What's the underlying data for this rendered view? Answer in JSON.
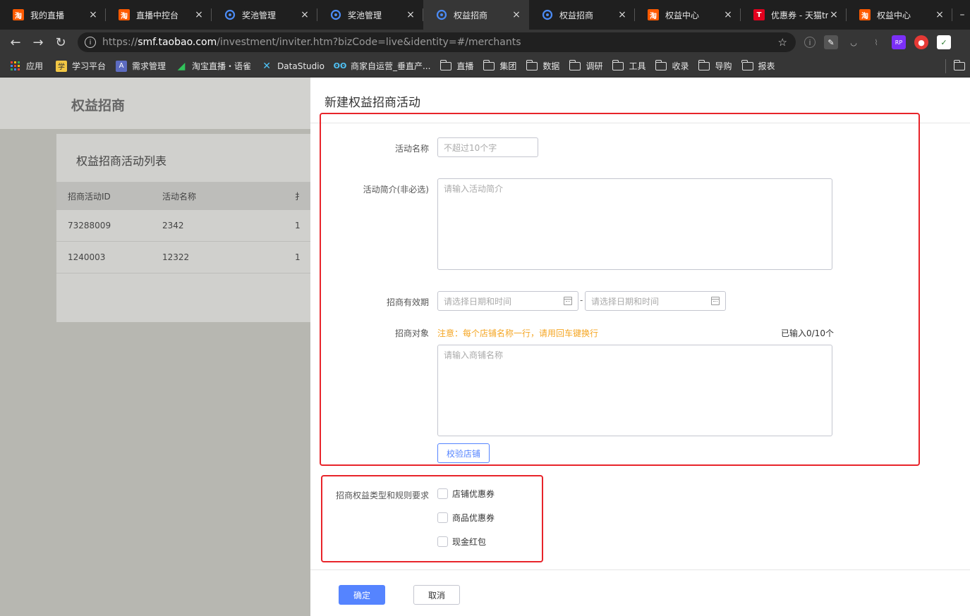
{
  "browser": {
    "tabs": [
      {
        "title": "我的直播",
        "favicon": "taobao-icon"
      },
      {
        "title": "直播中控台",
        "favicon": "taobao-icon"
      },
      {
        "title": "奖池管理",
        "favicon": "pool-icon"
      },
      {
        "title": "奖池管理",
        "favicon": "pool-icon"
      },
      {
        "title": "权益招商",
        "favicon": "pool-icon",
        "active": true
      },
      {
        "title": "权益招商",
        "favicon": "pool-icon"
      },
      {
        "title": "权益中心",
        "favicon": "taobao-icon"
      },
      {
        "title": "优惠券 - 天猫tm",
        "favicon": "tmall-icon"
      },
      {
        "title": "权益中心",
        "favicon": "taobao-icon"
      }
    ],
    "close_glyph": "×",
    "url_scheme": "https://",
    "url_host": "smf.taobao.com",
    "url_rest": "/investment/inviter.htm?bizCode=live&identity=#/merchants",
    "bookmarks": [
      {
        "label": "应用",
        "icon": "apps-grid-icon"
      },
      {
        "label": "学习平台",
        "icon": "study-icon"
      },
      {
        "label": "需求管理",
        "icon": "letter-a-icon"
      },
      {
        "label": "淘宝直播・语雀",
        "icon": "yuque-icon"
      },
      {
        "label": "DataStudio",
        "icon": "datastudio-icon"
      },
      {
        "label": "商家自运营_垂直产...",
        "icon": "link-icon"
      },
      {
        "label": "直播",
        "icon": "folder-icon"
      },
      {
        "label": "集团",
        "icon": "folder-icon"
      },
      {
        "label": "数据",
        "icon": "folder-icon"
      },
      {
        "label": "调研",
        "icon": "folder-icon"
      },
      {
        "label": "工具",
        "icon": "folder-icon"
      },
      {
        "label": "收录",
        "icon": "folder-icon"
      },
      {
        "label": "导购",
        "icon": "folder-icon"
      },
      {
        "label": "报表",
        "icon": "folder-icon"
      }
    ]
  },
  "background_page": {
    "header_title": "权益招商",
    "card_title": "权益招商活动列表",
    "table": {
      "columns": [
        "招商活动ID",
        "活动名称",
        "扌"
      ],
      "rows": [
        [
          "73288009",
          "2342",
          "1"
        ],
        [
          "1240003",
          "12322",
          "1"
        ]
      ]
    }
  },
  "drawer": {
    "title": "新建权益招商活动",
    "form": {
      "name_label": "活动名称",
      "name_placeholder": "不超过10个字",
      "intro_label": "活动简介(非必选)",
      "intro_placeholder": "请输入活动简介",
      "period_label": "招商有效期",
      "start_placeholder": "请选择日期和时间",
      "period_separator": "-",
      "end_placeholder": "请选择日期和时间",
      "target_label": "招商对象",
      "target_notice": "注意：每个店铺名称一行，请用回车键换行",
      "target_counter": "已输入0/10个",
      "target_placeholder": "请输入商铺名称",
      "verify_button": "校验店铺",
      "rights_label": "招商权益类型和规则要求",
      "rights_options": [
        "店铺优惠券",
        "商品优惠券",
        "现金红包"
      ]
    },
    "confirm_button": "确定",
    "cancel_button": "取消"
  },
  "colors": {
    "primary": "#5584ff",
    "notice": "#f5a623",
    "annotation_red": "#e8242a"
  }
}
